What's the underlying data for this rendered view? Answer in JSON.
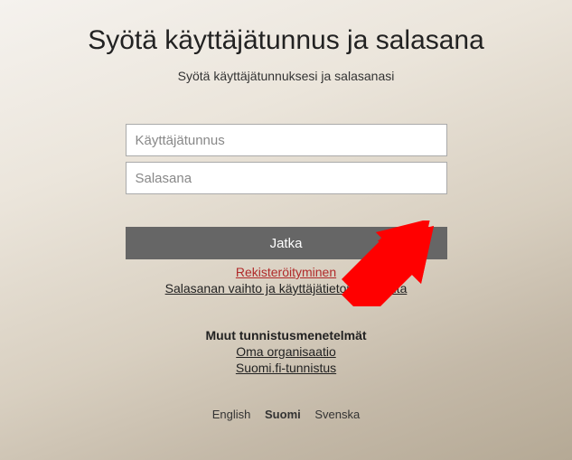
{
  "title": "Syötä käyttäjätunnus ja salasana",
  "subtitle": "Syötä käyttäjätunnuksesi ja salasanasi",
  "form": {
    "username_placeholder": "Käyttäjätunnus",
    "password_placeholder": "Salasana",
    "submit_label": "Jatka"
  },
  "links": {
    "register": "Rekisteröityminen",
    "manage": "Salasanan vaihto ja käyttäjätietojen hallinta"
  },
  "other_methods": {
    "heading": "Muut tunnistusmenetelmät",
    "own_org": "Oma organisaatio",
    "suomifi": "Suomi.fi-tunnistus"
  },
  "languages": {
    "english": "English",
    "suomi": "Suomi",
    "svenska": "Svenska"
  }
}
